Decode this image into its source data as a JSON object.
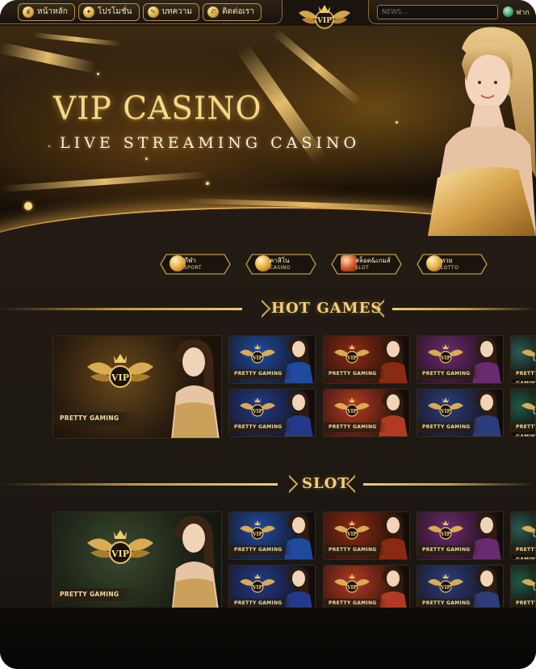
{
  "nav": {
    "items": [
      {
        "label": "หน้าหลัก",
        "icon": "home-trophy-icon"
      },
      {
        "label": "โปรโมชั่น",
        "icon": "gift-icon"
      },
      {
        "label": "บทความ",
        "icon": "article-pen-icon"
      },
      {
        "label": "ติดต่อเรา",
        "icon": "chat-contact-icon"
      }
    ],
    "logo_text": "VIP",
    "news_placeholder": "NEWS...",
    "language_label": "ฟาก"
  },
  "hero": {
    "title": "VIP CASINO",
    "subtitle": "LIVE STREAMING CASINO"
  },
  "categories": [
    {
      "th": "กีฬา",
      "en": "SPORT",
      "icon": "sport-chip-icon"
    },
    {
      "th": "คาสิโน",
      "en": "CASINO",
      "icon": "casino-chip-icon"
    },
    {
      "th": "สล็อต&เกมส์",
      "en": "SLOT",
      "icon": "slot-machine-icon"
    },
    {
      "th": "หวย",
      "en": "LOTTO",
      "icon": "lotto-balls-icon"
    }
  ],
  "sections": {
    "hot_games": {
      "title": "HOT GAMES",
      "featured_label": "PRETTY GAMING",
      "card_label": "PRETTY GAMING",
      "logo_text": "VIP"
    },
    "slot": {
      "title": "SLOT",
      "featured_label": "PRETTY GAMING",
      "card_label": "PRETTY GAMING",
      "logo_text": "VIP"
    }
  },
  "colors": {
    "gold": "#f2cf7a",
    "dark_bg": "#1d1812",
    "card_themes": [
      "#1f4aa0",
      "#8a2a14",
      "#6a2a6f",
      "#2a5c54",
      "#233a8a",
      "#b23a22",
      "#2b3d7a",
      "#1f5a44"
    ]
  }
}
